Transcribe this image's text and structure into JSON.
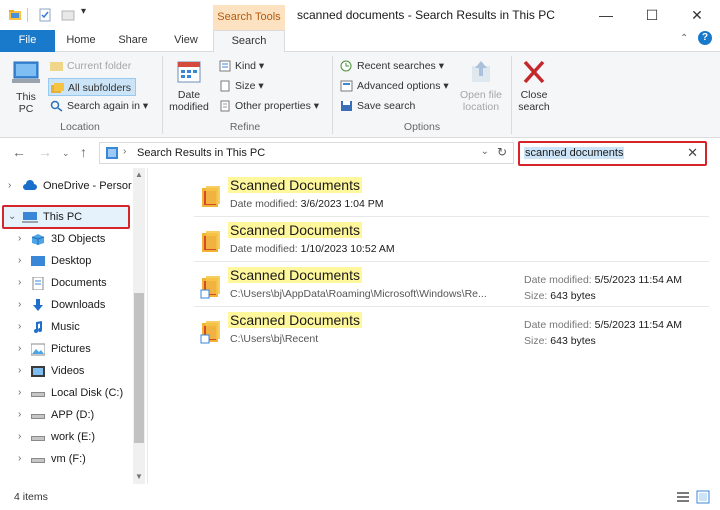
{
  "window": {
    "title": "scanned documents - Search Results in This PC",
    "context_tab": "Search Tools",
    "controls": {
      "minimize": "—",
      "maximize": "☐",
      "close": "✕"
    }
  },
  "tabs": [
    {
      "label": "File"
    },
    {
      "label": "Home"
    },
    {
      "label": "Share"
    },
    {
      "label": "View"
    },
    {
      "label": "Search"
    }
  ],
  "ribbon": {
    "location": {
      "label": "Location",
      "this_pc": "This PC",
      "current_folder": "Current folder",
      "all_subfolders": "All subfolders",
      "search_again_in": "Search again in"
    },
    "refine": {
      "label": "Refine",
      "date_modified": "Date modified",
      "kind": "Kind",
      "size": "Size",
      "other_properties": "Other properties"
    },
    "options": {
      "label": "Options",
      "recent_searches": "Recent searches",
      "advanced_options": "Advanced options",
      "save_search": "Save search",
      "open_file_location": "Open file location",
      "close_search": "Close search"
    }
  },
  "address": {
    "path": "Search Results in This PC",
    "search_value": "scanned documents"
  },
  "nav": {
    "items": [
      {
        "label": "OneDrive - Persor",
        "icon": "cloud-icon"
      },
      {
        "label": "This PC",
        "icon": "pc-icon"
      },
      {
        "label": "3D Objects",
        "icon": "cube-icon"
      },
      {
        "label": "Desktop",
        "icon": "desktop-icon"
      },
      {
        "label": "Documents",
        "icon": "documents-icon"
      },
      {
        "label": "Downloads",
        "icon": "download-icon"
      },
      {
        "label": "Music",
        "icon": "music-icon"
      },
      {
        "label": "Pictures",
        "icon": "pictures-icon"
      },
      {
        "label": "Videos",
        "icon": "videos-icon"
      },
      {
        "label": "Local Disk (C:)",
        "icon": "drive-icon"
      },
      {
        "label": "APP (D:)",
        "icon": "drive-icon"
      },
      {
        "label": "work (E:)",
        "icon": "drive-icon"
      },
      {
        "label": "vm (F:)",
        "icon": "drive-icon"
      }
    ]
  },
  "results": [
    {
      "name": "Scanned Documents",
      "sub_label": "Date modified:",
      "sub_value": "3/6/2023 1:04 PM"
    },
    {
      "name": "Scanned Documents",
      "sub_label": "Date modified:",
      "sub_value": "1/10/2023 10:52 AM"
    },
    {
      "name": "Scanned Documents",
      "path": "C:\\Users\\bj\\AppData\\Roaming\\Microsoft\\Windows\\Re...",
      "date_label": "Date modified:",
      "date_value": "5/5/2023 11:54 AM",
      "size_label": "Size:",
      "size_value": "643 bytes"
    },
    {
      "name": "Scanned Documents",
      "path": "C:\\Users\\bj\\Recent",
      "date_label": "Date modified:",
      "date_value": "5/5/2023 11:54 AM",
      "size_label": "Size:",
      "size_value": "643 bytes"
    }
  ],
  "status": {
    "count": "4 items"
  },
  "colors": {
    "accent": "#1979ca",
    "highlight_border": "#d6242b",
    "match_highlight": "#fff79b",
    "context_tab": "#fde2c1"
  }
}
